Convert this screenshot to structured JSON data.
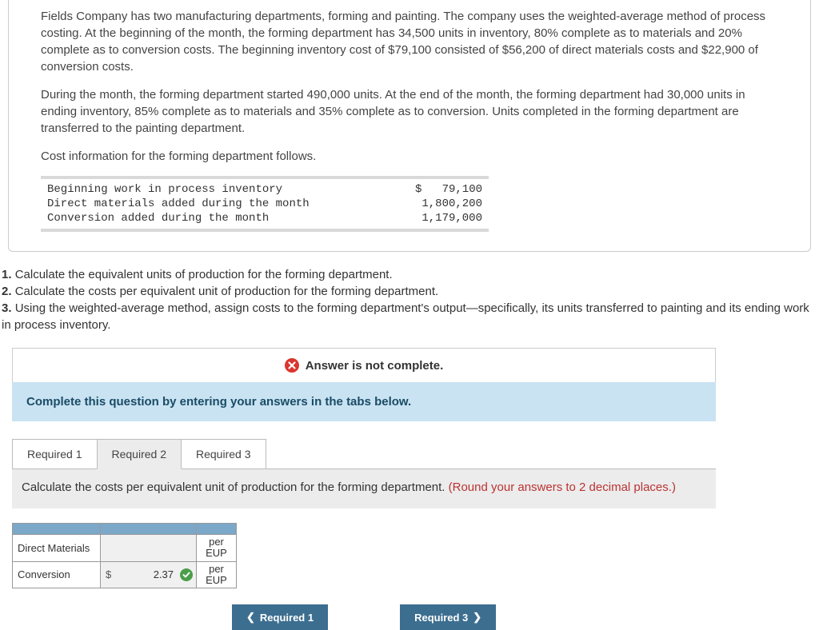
{
  "problem": {
    "p1": "Fields Company has two manufacturing departments, forming and painting. The company uses the weighted-average method of process costing. At the beginning of the month, the forming department has 34,500 units in inventory, 80% complete as to materials and 20% complete as to conversion costs. The beginning inventory cost of $79,100 consisted of $56,200 of direct materials costs and $22,900 of conversion costs.",
    "p2": "During the month, the forming department started 490,000 units. At the end of the month, the forming department had 30,000 units in ending inventory, 85% complete as to materials and 35% complete as to conversion. Units completed in the forming department are transferred to the painting department.",
    "p3": "Cost information for the forming department follows.",
    "costs": [
      {
        "label": "Beginning work in process inventory",
        "value": "$   79,100"
      },
      {
        "label": "Direct materials added during the month",
        "value": "1,800,200"
      },
      {
        "label": "Conversion added during the month",
        "value": "1,179,000"
      }
    ]
  },
  "questions": {
    "q1": "Calculate the equivalent units of production for the forming department.",
    "q2": "Calculate the costs per equivalent unit of production for the forming department.",
    "q3": "Using the weighted-average method, assign costs to the forming department's output—specifically, its units transferred to painting and its ending work in process inventory."
  },
  "status": {
    "message": "Answer is not complete."
  },
  "instruction": "Complete this question by entering your answers in the tabs below.",
  "tabs": {
    "t1": "Required 1",
    "t2": "Required 2",
    "t3": "Required 3"
  },
  "tab_content": {
    "prompt": "Calculate the costs per equivalent unit of production for the forming department.",
    "hint": "(Round your answers to 2 decimal places.)"
  },
  "answers": {
    "row1_label": "Direct Materials",
    "row1_value": "",
    "row2_label": "Conversion",
    "row2_currency": "$",
    "row2_value": "2.37",
    "unit": "per EUP"
  },
  "nav": {
    "prev": "Required 1",
    "next": "Required 3"
  }
}
